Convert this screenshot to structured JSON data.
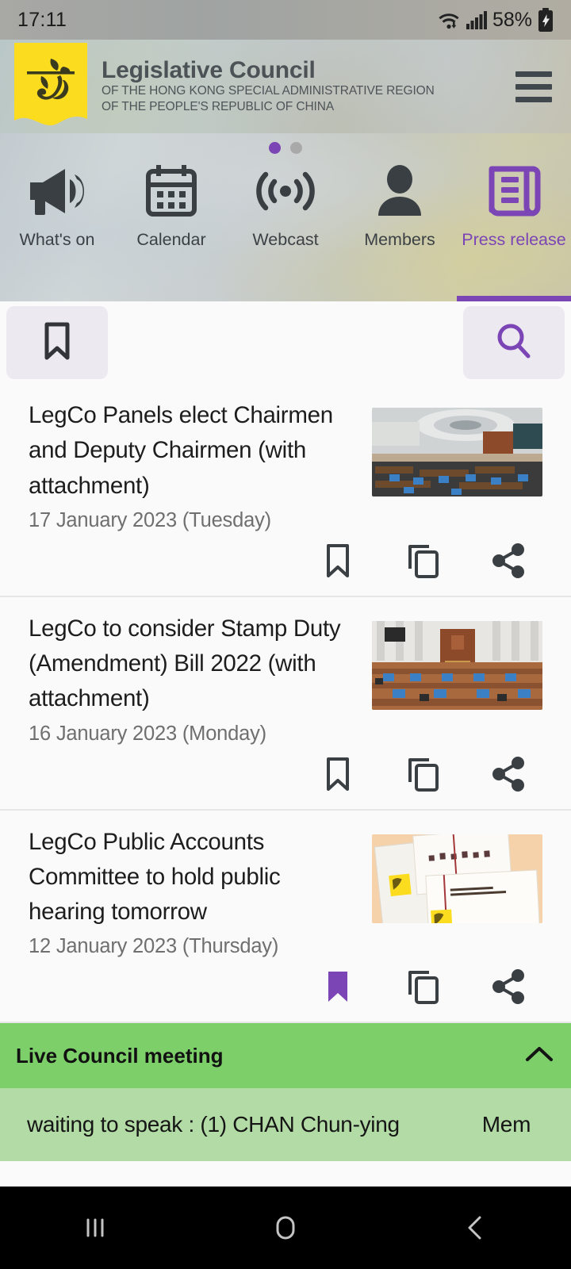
{
  "status_bar": {
    "time": "17:11",
    "battery_percent": "58%",
    "icons": [
      "wifi-icon",
      "signal-icon",
      "battery-charging-icon"
    ]
  },
  "header": {
    "title": "Legislative Council",
    "subtitle_line1": "OF THE HONG KONG SPECIAL ADMINISTRATIVE REGION",
    "subtitle_line2": "OF THE PEOPLE'S REPUBLIC OF CHINA",
    "logo_name": "legco-bauhinia-logo",
    "menu_icon": "hamburger-menu-icon"
  },
  "tabstrip": {
    "pager": {
      "total": 2,
      "active_index": 0,
      "active_color": "#7b45b5",
      "inactive_color": "#a9a9a9"
    },
    "tabs": [
      {
        "label": "What's on",
        "icon": "megaphone-icon",
        "active": false
      },
      {
        "label": "Calendar",
        "icon": "calendar-icon",
        "active": false
      },
      {
        "label": "Webcast",
        "icon": "broadcast-icon",
        "active": false
      },
      {
        "label": "Members",
        "icon": "person-icon",
        "active": false
      },
      {
        "label": "Press release",
        "icon": "scroll-document-icon",
        "active": true
      }
    ]
  },
  "toolbar": {
    "bookmark_label": "Bookmarks",
    "bookmark_icon": "bookmark-icon",
    "search_label": "Search",
    "search_icon": "search-icon"
  },
  "news": {
    "items": [
      {
        "title": "LegCo Panels elect Chairmen and Deputy Chairmen (with attachment)",
        "date": "17 January 2023 (Tuesday)",
        "thumbnail": "legco-chamber-ceiling-photo",
        "bookmarked": false,
        "actions": [
          "bookmark-icon",
          "copy-icon",
          "share-icon"
        ]
      },
      {
        "title": "LegCo to consider Stamp Duty (Amendment) Bill 2022 (with attachment)",
        "date": "16 January 2023 (Monday)",
        "thumbnail": "legco-chamber-desks-photo",
        "bookmarked": false,
        "actions": [
          "bookmark-icon",
          "copy-icon",
          "share-icon"
        ]
      },
      {
        "title": "LegCo Public Accounts Committee to hold public hearing tomorrow",
        "date": "12 January 2023 (Thursday)",
        "thumbnail": "public-accounts-committee-report-photo",
        "bookmarked": true,
        "actions": [
          "bookmark-icon",
          "copy-icon",
          "share-icon"
        ]
      }
    ]
  },
  "live": {
    "banner_title": "Live Council meeting",
    "collapse_icon": "chevron-up-icon",
    "banner_color": "#7dcf6a",
    "ticker_color": "#b3dba6",
    "ticker_text": "waiting to speak : (1) CHAN Chun-ying",
    "ticker_text_truncated": "Mem"
  },
  "android_nav": {
    "recents_label": "Recents",
    "home_label": "Home",
    "back_label": "Back"
  },
  "colors": {
    "accent": "#7b45b5",
    "logo_yellow": "#fcdc1e",
    "page_bg": "#fafafa"
  }
}
